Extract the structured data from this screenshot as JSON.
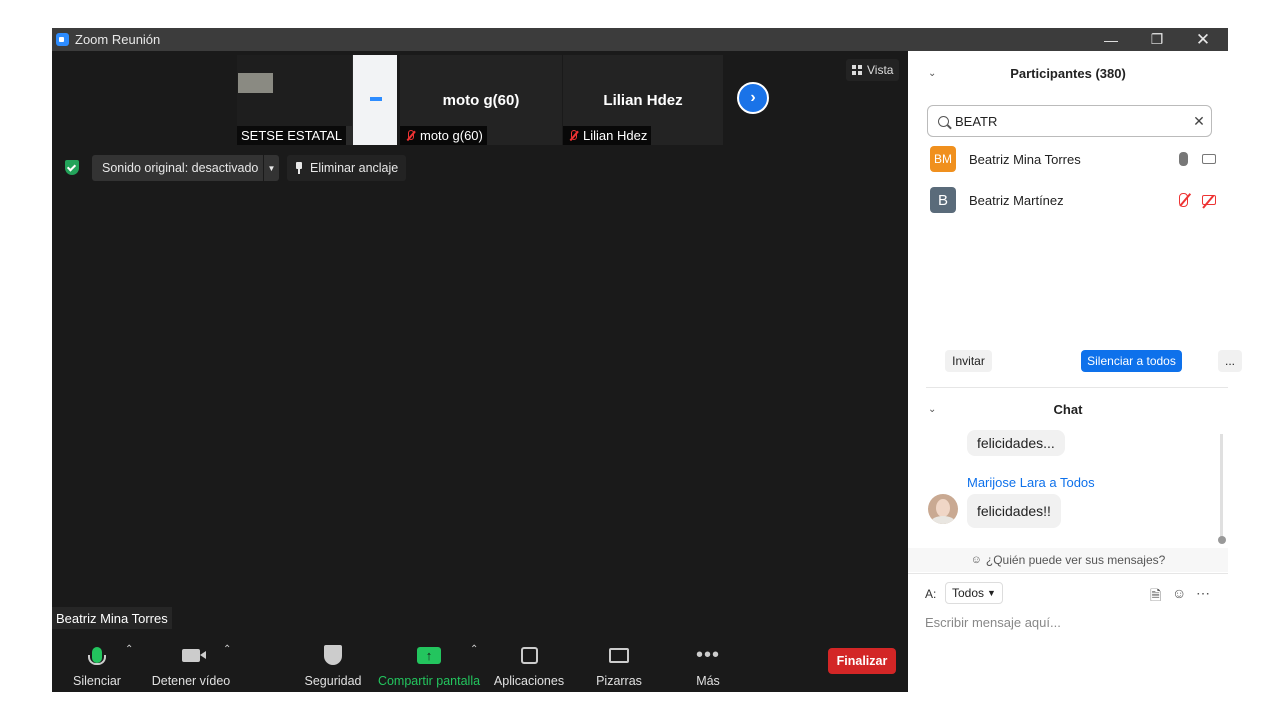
{
  "window": {
    "title": "Zoom Reunión"
  },
  "thumbnails": [
    {
      "label": "SETSE ESTATAL"
    },
    {
      "name": "moto g(60)",
      "label": "moto g(60)"
    },
    {
      "name": "Lilian Hdez",
      "label": "Lilian Hdez"
    }
  ],
  "view_button": "Vista",
  "sound_button": "Sonido original: desactivado",
  "unpin_button": "Eliminar anclaje",
  "active_speaker": "Beatriz Mina Torres",
  "toolbar": {
    "mute": "Silenciar",
    "video": "Detener vídeo",
    "security": "Seguridad",
    "share": "Compartir pantalla",
    "apps": "Aplicaciones",
    "whiteboards": "Pizarras",
    "more": "Más",
    "end": "Finalizar"
  },
  "participants": {
    "title": "Participantes (380)",
    "search_value": "BEATR",
    "list": [
      {
        "initials": "BM",
        "name": "Beatriz Mina Torres",
        "color": "#f0901e",
        "muted": false
      },
      {
        "initials": "B",
        "name": "Beatriz Martínez",
        "color": "#5a6b7a",
        "muted": true
      }
    ],
    "invite": "Invitar",
    "mute_all": "Silenciar a todos",
    "more": "..."
  },
  "chat": {
    "title": "Chat",
    "prev_message": "felicidades...",
    "sender": "Marijose Lara a Todos",
    "message": "felicidades!!",
    "who_can_see": "¿Quién puede ver sus mensajes?",
    "to_label": "A:",
    "to_value": "Todos",
    "placeholder": "Escribir mensaje aquí..."
  }
}
